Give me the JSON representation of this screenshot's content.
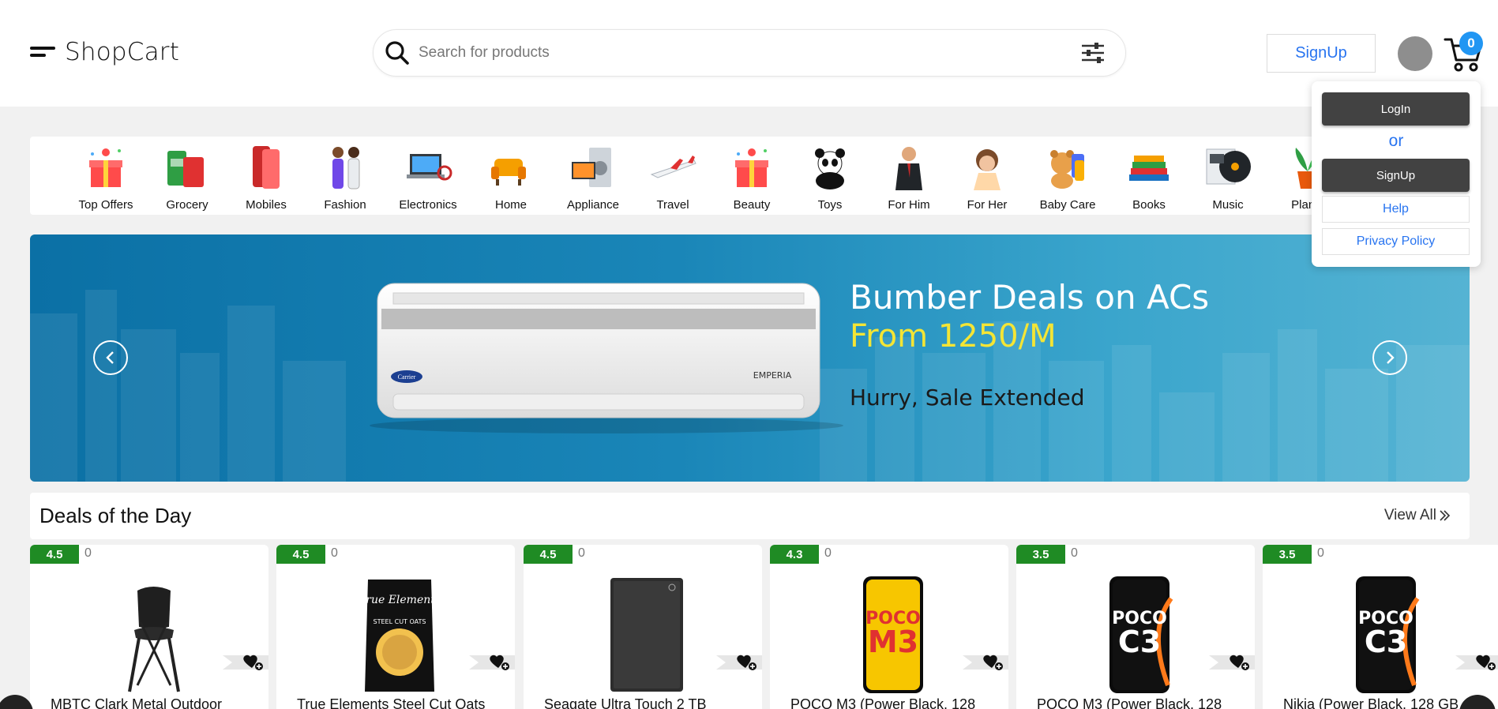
{
  "header": {
    "brand": "ShopCart",
    "search_placeholder": "Search for products",
    "signup_label": "SignUp",
    "cart_count": "0"
  },
  "dropdown": {
    "login_label": "LogIn",
    "or_label": "or",
    "signup_label": "SignUp",
    "help_label": "Help",
    "privacy_label": "Privacy Policy"
  },
  "categories": [
    {
      "label": "Top Offers",
      "icon": "gift-icon"
    },
    {
      "label": "Grocery",
      "icon": "grocery-icon"
    },
    {
      "label": "Mobiles",
      "icon": "mobile-icon"
    },
    {
      "label": "Fashion",
      "icon": "fashion-icon"
    },
    {
      "label": "Electronics",
      "icon": "laptop-icon"
    },
    {
      "label": "Home",
      "icon": "sofa-icon"
    },
    {
      "label": "Appliance",
      "icon": "appliance-icon"
    },
    {
      "label": "Travel",
      "icon": "airplane-icon"
    },
    {
      "label": "Beauty",
      "icon": "gift-icon"
    },
    {
      "label": "Toys",
      "icon": "panda-icon"
    },
    {
      "label": "For Him",
      "icon": "man-icon"
    },
    {
      "label": "For Her",
      "icon": "woman-icon"
    },
    {
      "label": "Baby Care",
      "icon": "teddy-icon"
    },
    {
      "label": "Books",
      "icon": "books-icon"
    },
    {
      "label": "Music",
      "icon": "music-icon"
    },
    {
      "label": "Plants",
      "icon": "plant-icon"
    }
  ],
  "banner": {
    "line1": "Bumber Deals on ACs",
    "line2": "From 1250/M",
    "line3": "Hurry, Sale Extended",
    "product_brand": "Carrier",
    "product_model": "EMPERIA"
  },
  "deals": {
    "title": "Deals of the Day",
    "view_all": "View All",
    "items": [
      {
        "rating": "4.5",
        "count": "0",
        "title": "MBTC Clark Metal Outdoor",
        "icon": "chair-icon"
      },
      {
        "rating": "4.5",
        "count": "0",
        "title": "True Elements Steel Cut Oats",
        "icon": "oats-pack-icon",
        "pack_brand": "True Elements",
        "pack_name": "STEEL CUT OATS"
      },
      {
        "rating": "4.5",
        "count": "0",
        "title": "Seagate Ultra Touch 2 TB",
        "icon": "hard-drive-icon"
      },
      {
        "rating": "4.3",
        "count": "0",
        "title": "POCO M3 (Power Black, 128",
        "icon": "phone-icon",
        "screen_text": "POCO M3"
      },
      {
        "rating": "3.5",
        "count": "0",
        "title": "POCO M3 (Power Black, 128",
        "icon": "phone-icon",
        "screen_text": "POCO C3"
      },
      {
        "rating": "3.5",
        "count": "0",
        "title": "Nikia (Power Black, 128 GB",
        "icon": "phone-icon",
        "screen_text": "POCO C3"
      }
    ]
  }
}
